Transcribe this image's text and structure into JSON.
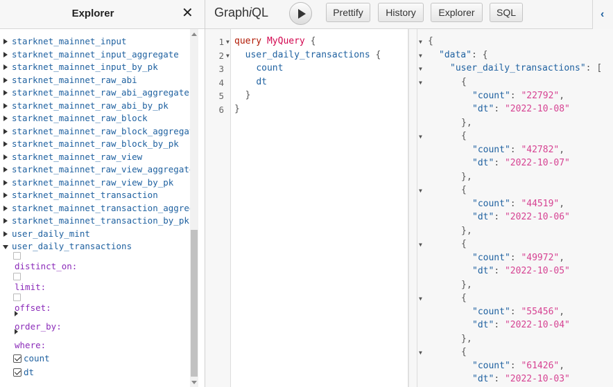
{
  "explorer": {
    "title": "Explorer",
    "close_glyph": "✕",
    "fields": [
      "starknet_mainnet_input",
      "starknet_mainnet_input_aggregate",
      "starknet_mainnet_input_by_pk",
      "starknet_mainnet_raw_abi",
      "starknet_mainnet_raw_abi_aggregate",
      "starknet_mainnet_raw_abi_by_pk",
      "starknet_mainnet_raw_block",
      "starknet_mainnet_raw_block_aggregate",
      "starknet_mainnet_raw_block_by_pk",
      "starknet_mainnet_raw_view",
      "starknet_mainnet_raw_view_aggregate",
      "starknet_mainnet_raw_view_by_pk",
      "starknet_mainnet_transaction",
      "starknet_mainnet_transaction_aggregate",
      "starknet_mainnet_transaction_by_pk",
      "user_daily_mint"
    ],
    "expanded_field": "user_daily_transactions",
    "args": [
      "distinct_on:",
      "limit:",
      "offset:",
      "order_by:",
      "where:"
    ],
    "checked_fields": [
      "count",
      "dt"
    ]
  },
  "toolbar": {
    "logo_pre": "Graph",
    "logo_i": "i",
    "logo_post": "QL",
    "prettify": "Prettify",
    "history": "History",
    "explorer": "Explorer",
    "sql": "SQL"
  },
  "editor": {
    "line_numbers": [
      "1",
      "2",
      "3",
      "4",
      "5",
      "6"
    ],
    "kw_query": "query",
    "op_name": "MyQuery",
    "open_brace": "{",
    "field": "user_daily_transactions",
    "sub_field_1": "count",
    "sub_field_2": "dt",
    "close_inner": "}",
    "close_outer": "}"
  },
  "result": {
    "data_key": "\"data\"",
    "table_key": "\"user_daily_transactions\"",
    "count_key": "\"count\"",
    "dt_key": "\"dt\"",
    "rows": [
      {
        "count": "\"22792\"",
        "dt": "\"2022-10-08\""
      },
      {
        "count": "\"42782\"",
        "dt": "\"2022-10-07\""
      },
      {
        "count": "\"44519\"",
        "dt": "\"2022-10-06\""
      },
      {
        "count": "\"49972\"",
        "dt": "\"2022-10-05\""
      },
      {
        "count": "\"55456\"",
        "dt": "\"2022-10-04\""
      },
      {
        "count": "\"61426\"",
        "dt": "\"2022-10-03\""
      }
    ]
  }
}
